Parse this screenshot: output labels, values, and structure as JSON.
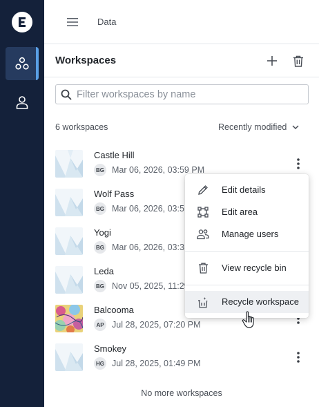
{
  "rail": {
    "logo_letter": "E",
    "items": [
      {
        "icon": "workspaces-icon",
        "active": true
      },
      {
        "icon": "user-icon",
        "active": false
      }
    ]
  },
  "topbar": {
    "breadcrumb": "Data"
  },
  "header": {
    "title": "Workspaces"
  },
  "search": {
    "placeholder": "Filter workspaces by name",
    "value": ""
  },
  "list": {
    "count_text": "6 workspaces",
    "sort_label": "Recently modified",
    "workspaces": [
      {
        "name": "Castle Hill",
        "initials": "BG",
        "modified": "Mar 06, 2026, 03:59 PM"
      },
      {
        "name": "Wolf Pass",
        "initials": "BG",
        "modified": "Mar 06, 2026, 03:5"
      },
      {
        "name": "Yogi",
        "initials": "BG",
        "modified": "Mar 06, 2026, 03:3"
      },
      {
        "name": "Leda",
        "initials": "BG",
        "modified": "Nov 05, 2025, 11:29"
      },
      {
        "name": "Balcooma",
        "initials": "AP",
        "modified": "Jul 28, 2025, 07:20 PM"
      },
      {
        "name": "Smokey",
        "initials": "HG",
        "modified": "Jul 28, 2025, 01:49 PM"
      }
    ],
    "end_note": "No more workspaces"
  },
  "context_menu": {
    "items": [
      {
        "label": "Edit details",
        "icon": "pencil-icon"
      },
      {
        "label": "Edit area",
        "icon": "polygon-area-icon"
      },
      {
        "label": "Manage users",
        "icon": "users-icon"
      },
      {
        "label": "View recycle bin",
        "icon": "trash-icon"
      },
      {
        "label": "Recycle workspace",
        "icon": "recycle-trash-icon",
        "hovered": true
      }
    ]
  },
  "colors": {
    "rail_bg": "#14213a",
    "rail_active_bg": "#263b5f",
    "rail_active_indicator": "#5aa0e6",
    "menu_hover_bg": "#eef0f3"
  }
}
